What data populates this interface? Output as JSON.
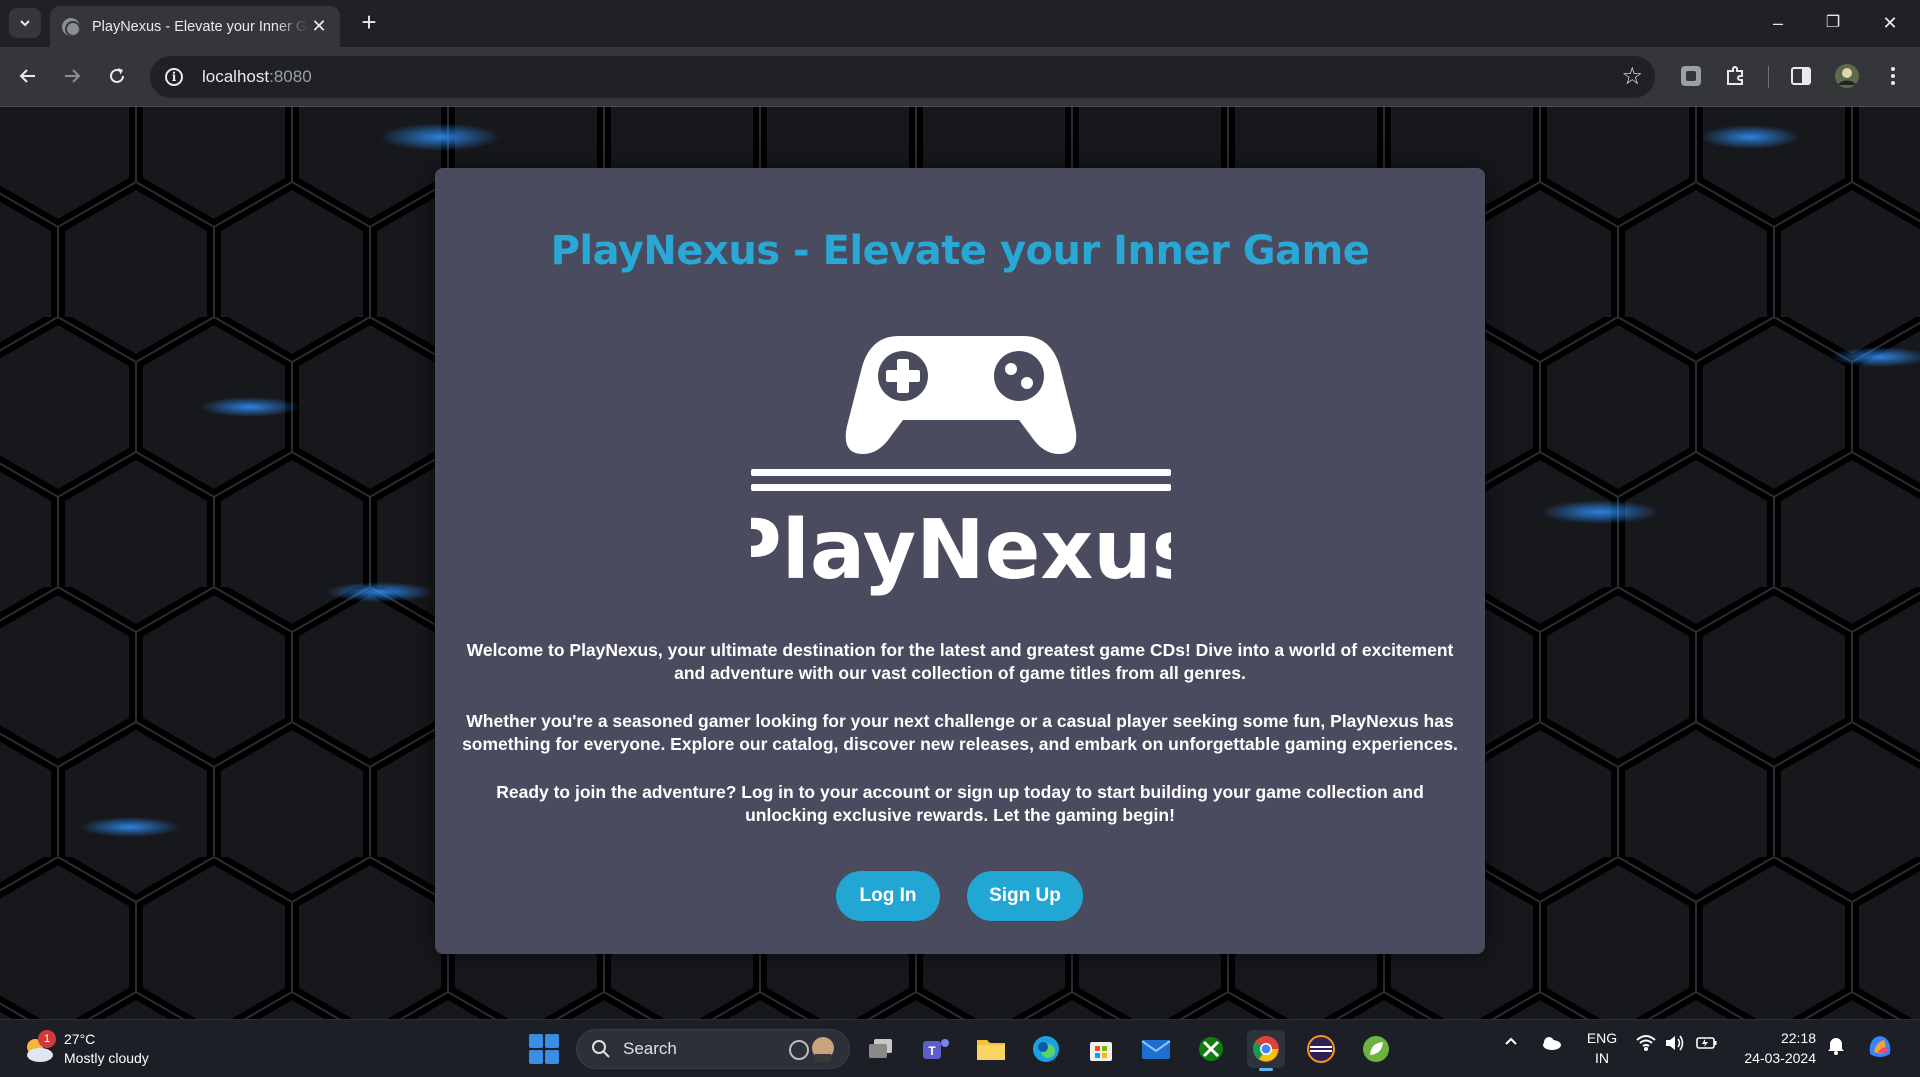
{
  "browser": {
    "tab_title": "PlayNexus - Elevate your Inner Game",
    "tab_close": "✕",
    "new_tab": "+",
    "url_host": "localhost",
    "url_port": ":8080",
    "window_controls": {
      "minimize": "–",
      "restore": "❐",
      "close": "✕"
    }
  },
  "page": {
    "title": "PlayNexus - Elevate your Inner Game",
    "logo_text": "PlayNexus",
    "paragraphs": [
      "Welcome to PlayNexus, your ultimate destination for the latest and greatest game CDs! Dive into a world of excitement and adventure with our vast collection of game titles from all genres.",
      "Whether you're a seasoned gamer looking for your next challenge or a casual player seeking some fun, PlayNexus has something for everyone. Explore our catalog, discover new releases, and embark on unforgettable gaming experiences.",
      "Ready to join the adventure? Log in to your account or sign up today to start building your game collection and unlocking exclusive rewards. Let the gaming begin!"
    ],
    "login_label": "Log In",
    "signup_label": "Sign Up",
    "accent_color": "#22a7d4",
    "card_color": "#4a4b5e"
  },
  "taskbar": {
    "weather_badge": "1",
    "temperature": "27°C",
    "weather_desc": "Mostly cloudy",
    "search_placeholder": "Search",
    "language": "ENG",
    "region": "IN",
    "time": "22:18",
    "date": "24-03-2024"
  }
}
